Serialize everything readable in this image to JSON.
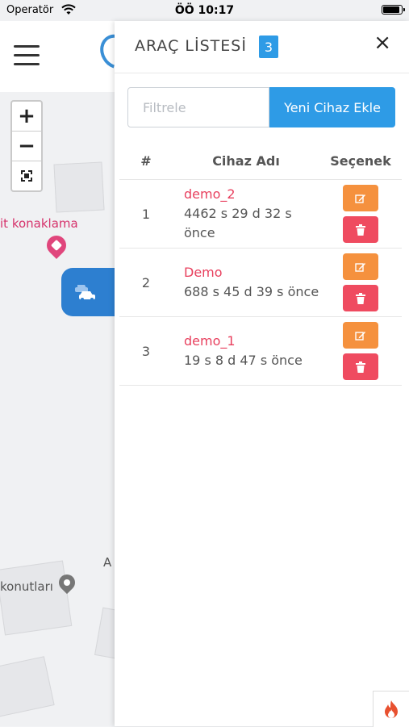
{
  "status_bar": {
    "carrier": "Operatör",
    "time": "ÖÖ 10:17"
  },
  "map": {
    "poi_label": "it konaklama",
    "place_label": "konutları",
    "edge_letter": "A",
    "zoom_in": "+",
    "zoom_out": "−",
    "fullscreen": "⛶"
  },
  "panel": {
    "title": "ARAÇ LİSTESİ",
    "count": "3",
    "close": "×",
    "filter_placeholder": "Filtrele",
    "filter_value": "",
    "add_button": "Yeni Cihaz Ekle",
    "columns": {
      "num": "#",
      "name": "Cihaz Adı",
      "options": "Seçenek"
    },
    "devices": [
      {
        "num": "1",
        "name": "demo_2",
        "last_seen": "4462 s 29 d 32 s önce"
      },
      {
        "num": "2",
        "name": "Demo",
        "last_seen": "688 s 45 d 39 s önce"
      },
      {
        "num": "3",
        "name": "demo_1",
        "last_seen": "19 s 8 d 47 s önce"
      }
    ]
  },
  "colors": {
    "accent": "#2e9be6",
    "device_name": "#e8405e",
    "edit": "#f5913e",
    "delete": "#ef4b60",
    "vehicle_toggle": "#2d7fd0"
  },
  "icons": [
    "wifi-icon",
    "battery-icon",
    "menu-icon",
    "car-icon",
    "edit-icon",
    "trash-icon",
    "fire-icon",
    "pin-icon"
  ]
}
